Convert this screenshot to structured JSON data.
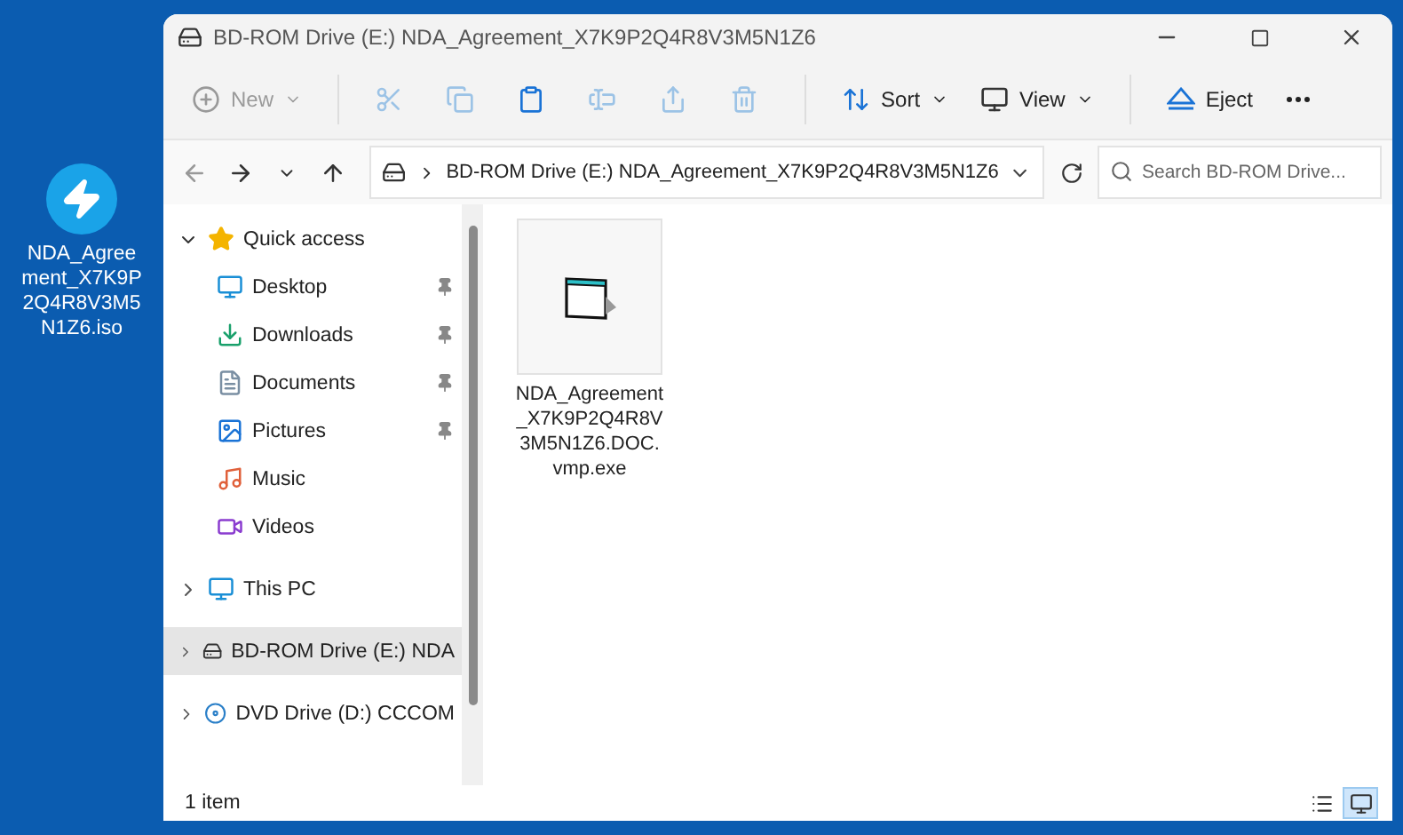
{
  "desktop_icon": {
    "label": "NDA_Agreement_X7K9P2Q4R8V3M5N1Z6.iso"
  },
  "window": {
    "title": "BD-ROM Drive (E:) NDA_Agreement_X7K9P2Q4R8V3M5N1Z6"
  },
  "toolbar": [
    {
      "kind": "new",
      "label": "New",
      "disabled": true
    },
    {
      "kind": "cut",
      "disabled": true
    },
    {
      "kind": "copy",
      "disabled": true
    },
    {
      "kind": "paste",
      "disabled": false
    },
    {
      "kind": "rename",
      "disabled": true
    },
    {
      "kind": "share",
      "disabled": true
    },
    {
      "kind": "delete",
      "disabled": true
    },
    {
      "kind": "sort",
      "label": "Sort",
      "disabled": false
    },
    {
      "kind": "view",
      "label": "View",
      "disabled": false
    },
    {
      "kind": "eject",
      "label": "Eject",
      "disabled": false
    },
    {
      "kind": "more",
      "disabled": false
    }
  ],
  "address": {
    "path": "BD-ROM Drive (E:) NDA_Agreement_X7K9P2Q4R8V3M5N1Z6"
  },
  "search": {
    "placeholder": "Search BD-ROM Drive..."
  },
  "sidebar": {
    "items": [
      {
        "label": "Quick access",
        "expanded": true,
        "selected": false,
        "children": [
          {
            "label": "Desktop",
            "pinned": true,
            "selected": false
          },
          {
            "label": "Downloads",
            "pinned": true,
            "selected": false
          },
          {
            "label": "Documents",
            "pinned": true,
            "selected": false
          },
          {
            "label": "Pictures",
            "pinned": true,
            "selected": false
          },
          {
            "label": "Music",
            "pinned": false,
            "selected": false
          },
          {
            "label": "Videos",
            "pinned": false,
            "selected": false
          }
        ]
      },
      {
        "label": "This PC",
        "expanded": false,
        "selected": false
      },
      {
        "label": "BD-ROM Drive (E:) NDA",
        "expanded": false,
        "selected": true
      },
      {
        "label": "DVD Drive (D:) CCCOM",
        "expanded": false,
        "selected": false
      }
    ]
  },
  "files": [
    {
      "name": "NDA_Agreement_X7K9P2Q4R8V3M5N1Z6.DOC.vmp.exe",
      "selected": false
    }
  ],
  "status_bar": {
    "count": "1 item",
    "views": [
      {
        "kind": "details",
        "selected": false
      },
      {
        "kind": "icons",
        "selected": true
      }
    ]
  }
}
